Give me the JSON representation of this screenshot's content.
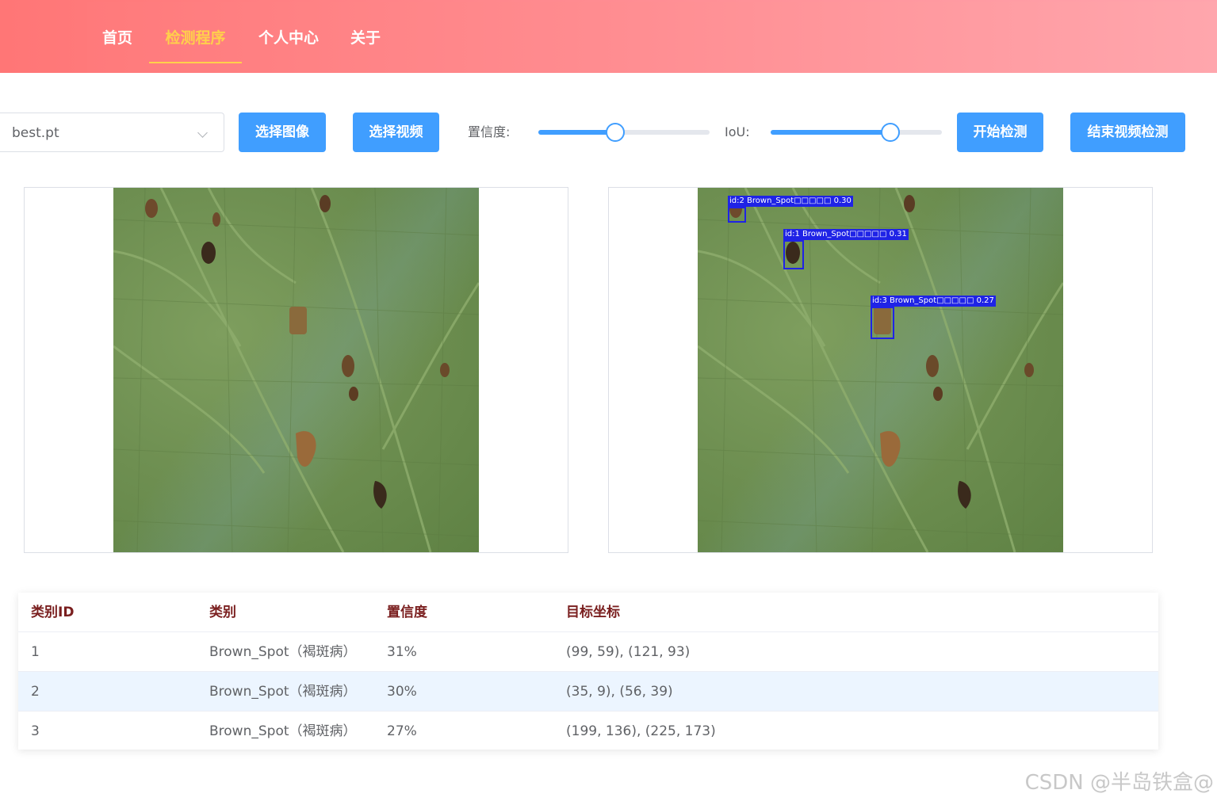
{
  "nav": {
    "items": [
      {
        "label": "首页",
        "active": false
      },
      {
        "label": "检测程序",
        "active": true
      },
      {
        "label": "个人中心",
        "active": false
      },
      {
        "label": "关于",
        "active": false
      }
    ],
    "active_color": "#ffd04b"
  },
  "toolbar": {
    "model_select": {
      "value": "best.pt"
    },
    "select_image_label": "选择图像",
    "select_video_label": "选择视频",
    "confidence_label": "置信度:",
    "confidence_value": 0.45,
    "iou_label": "IoU:",
    "iou_value": 0.7,
    "start_label": "开始检测",
    "stop_video_label": "结束视频检测",
    "accent": "#409eff"
  },
  "detections": [
    {
      "label": "id:2 Brown_Spot□□□□□ 0.30"
    },
    {
      "label": "id:1 Brown_Spot□□□□□ 0.31"
    },
    {
      "label": "id:3 Brown_Spot□□□□□ 0.27"
    }
  ],
  "table": {
    "headers": [
      "类别ID",
      "类别",
      "置信度",
      "目标坐标"
    ],
    "rows": [
      [
        "1",
        "Brown_Spot（褐斑病）",
        "31%",
        "(99, 59), (121, 93)"
      ],
      [
        "2",
        "Brown_Spot（褐斑病）",
        "30%",
        "(35, 9), (56, 39)"
      ],
      [
        "3",
        "Brown_Spot（褐斑病）",
        "27%",
        "(199, 136), (225, 173)"
      ]
    ]
  },
  "watermark": "CSDN @半岛铁盒@"
}
